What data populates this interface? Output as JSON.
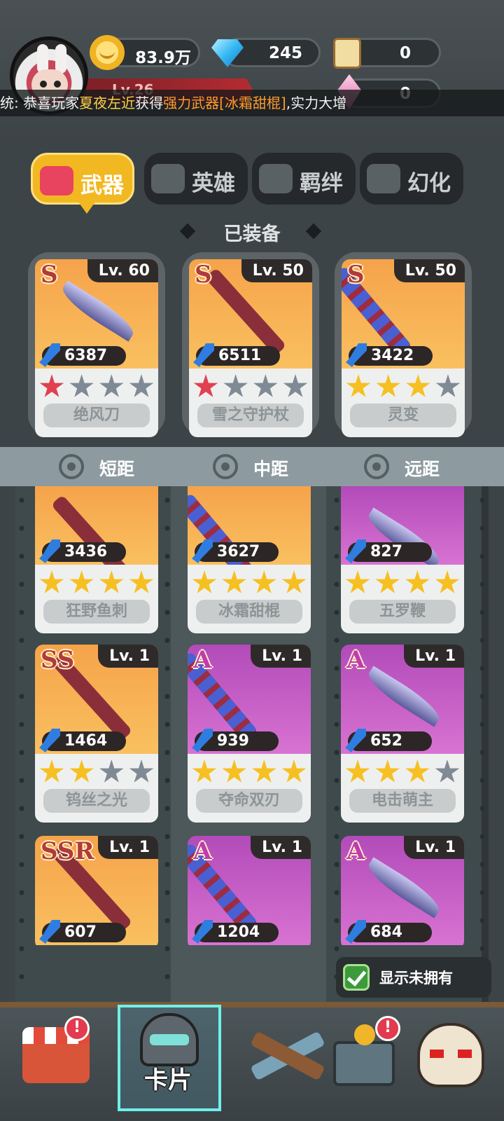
{
  "resources": {
    "gold": "83.9万",
    "diamonds": "245",
    "scrolls": "0",
    "crystals": "0"
  },
  "player": {
    "level_text": "Lv.26"
  },
  "ticker": {
    "prefix": "统",
    "part1": ": 恭喜玩家",
    "player_name": "夏夜左近",
    "part2": "获得",
    "category": "强力武器",
    "item": "[冰霜甜棍]",
    "part3": ",实力大增"
  },
  "tabs": [
    {
      "label": "武器",
      "active": true
    },
    {
      "label": "英雄",
      "active": false
    },
    {
      "label": "羁绊",
      "active": false
    },
    {
      "label": "幻化",
      "active": false
    }
  ],
  "equipped_title": "已装备",
  "equipped": [
    {
      "rank": "S",
      "level": "Lv. 60",
      "power": "6387",
      "name": "绝风刀",
      "stars": [
        "red",
        "gray",
        "gray",
        "gray"
      ],
      "bg": "orange"
    },
    {
      "rank": "S",
      "level": "Lv. 50",
      "power": "6511",
      "name": "雪之守护杖",
      "stars": [
        "red",
        "gray",
        "gray",
        "gray"
      ],
      "bg": "orange"
    },
    {
      "rank": "S",
      "level": "Lv. 50",
      "power": "3422",
      "name": "灵变",
      "stars": [
        "gold",
        "gold",
        "gold",
        "gray"
      ],
      "bg": "orange"
    }
  ],
  "ranges": [
    "短距",
    "中距",
    "远距"
  ],
  "collection": [
    {
      "rank": "",
      "level": "",
      "power": "3436",
      "name": "狂野鱼刺",
      "stars": [
        "gold",
        "gold",
        "gold",
        "gold"
      ],
      "bg": "orange"
    },
    {
      "rank": "",
      "level": "",
      "power": "3627",
      "name": "冰霜甜棍",
      "stars": [
        "gold",
        "gold",
        "gold",
        "gold"
      ],
      "bg": "orange"
    },
    {
      "rank": "",
      "level": "",
      "power": "827",
      "name": "五罗鞭",
      "stars": [
        "gold",
        "gold",
        "gold",
        "gold"
      ],
      "bg": "purple"
    },
    {
      "rank": "SS",
      "level": "Lv. 1",
      "power": "1464",
      "name": "钨丝之光",
      "stars": [
        "gold",
        "gold",
        "gray",
        "gray"
      ],
      "bg": "orange"
    },
    {
      "rank": "A",
      "level": "Lv. 1",
      "power": "939",
      "name": "夺命双刃",
      "stars": [
        "gold",
        "gold",
        "gold",
        "gold"
      ],
      "bg": "purple"
    },
    {
      "rank": "A",
      "level": "Lv. 1",
      "power": "652",
      "name": "电击萌主",
      "stars": [
        "gold",
        "gold",
        "gold",
        "gray"
      ],
      "bg": "purple"
    },
    {
      "rank": "SSR",
      "level": "Lv. 1",
      "power": "607",
      "name": "",
      "stars": [],
      "bg": "orange"
    },
    {
      "rank": "A",
      "level": "Lv. 1",
      "power": "1204",
      "name": "",
      "stars": [],
      "bg": "purple"
    },
    {
      "rank": "A",
      "level": "Lv. 1",
      "power": "684",
      "name": "",
      "stars": [],
      "bg": "purple"
    }
  ],
  "show_unowned": {
    "label": "显示未拥有",
    "checked": true
  },
  "nav": {
    "card_label": "卡片",
    "badge": "!"
  }
}
